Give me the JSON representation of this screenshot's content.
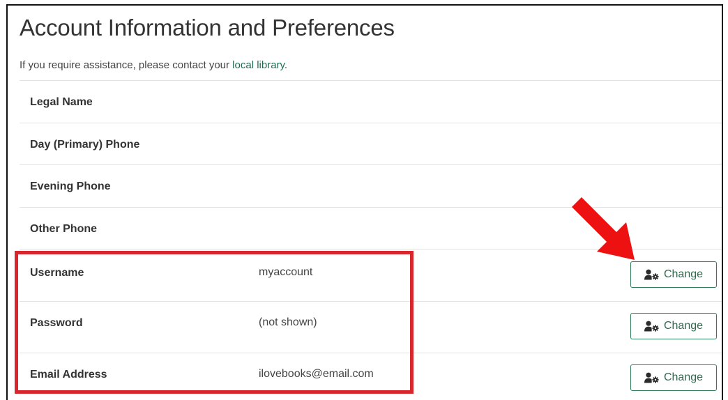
{
  "page": {
    "title": "Account Information and Preferences",
    "assist_prefix": "If you require assistance, please contact your ",
    "assist_link": "local library",
    "assist_suffix": "."
  },
  "rows": [
    {
      "label": "Legal Name",
      "value": ""
    },
    {
      "label": "Day (Primary) Phone",
      "value": ""
    },
    {
      "label": "Evening Phone",
      "value": ""
    },
    {
      "label": "Other Phone",
      "value": ""
    },
    {
      "label": "Username",
      "value": "myaccount",
      "button": "Change"
    },
    {
      "label": "Password",
      "value": "(not shown)",
      "button": "Change"
    },
    {
      "label": "Email Address",
      "value": "ilovebooks@email.com",
      "button": "Change"
    }
  ],
  "icons": {
    "change_button_icon": "user-gear-icon",
    "annotation_arrow": "arrow-icon"
  },
  "colors": {
    "accent_green": "#2e7d5b",
    "link_green": "#1e6b52",
    "highlight_red": "#d9252c",
    "arrow_red": "#ee1111"
  }
}
